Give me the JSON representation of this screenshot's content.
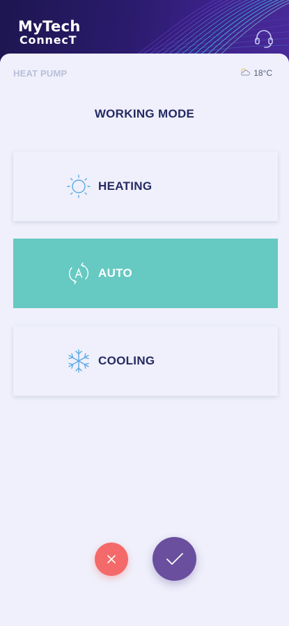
{
  "app": {
    "logo_line1": "MyTech",
    "logo_line2": "ConnecT"
  },
  "icons": {
    "support": "headset-icon",
    "weather": "cloud-sun-icon",
    "cancel": "close-icon",
    "confirm": "check-icon"
  },
  "device": {
    "label": "HEAT PUMP",
    "temperature": "18°C"
  },
  "screen": {
    "title": "WORKING MODE"
  },
  "modes": [
    {
      "label": "HEATING",
      "icon": "sun-icon",
      "selected": false
    },
    {
      "label": "AUTO",
      "icon": "auto-mode-icon",
      "selected": true
    },
    {
      "label": "COOLING",
      "icon": "snowflake-icon",
      "selected": false
    }
  ],
  "colors": {
    "header_bg": "#2b1b6d",
    "selected_mode": "#66c9c2",
    "cancel": "#f46a6a",
    "confirm": "#6a4f9e",
    "text_dark": "#252a62",
    "icon_blue": "#5aa9e6"
  }
}
